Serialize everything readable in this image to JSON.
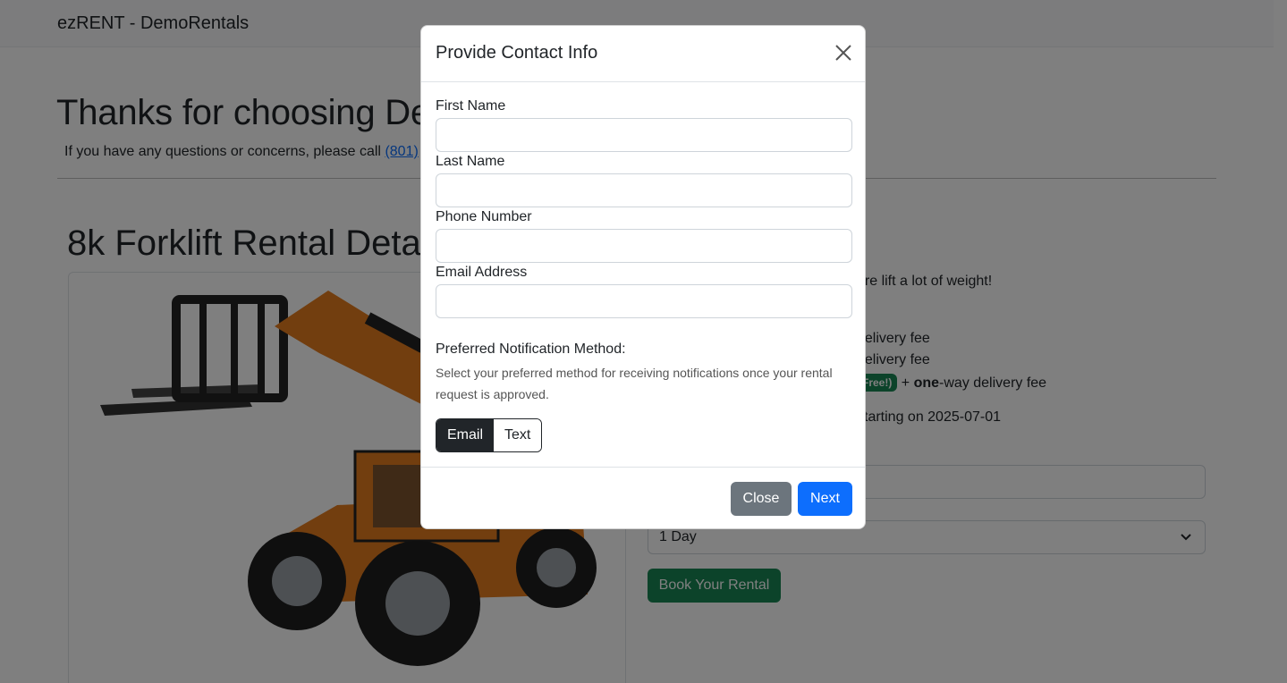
{
  "navbar": {
    "brand": "ezRENT - DemoRentals"
  },
  "hero": {
    "title": "Thanks for choosing De",
    "subtitle_prefix": "If you have any questions or concerns, please call ",
    "phone_link": "(801)"
  },
  "detail": {
    "title": "8k Forklift Rental Detai",
    "line1": "ure lift a lot of weight!",
    "line2": "delivery fee",
    "line3": "delivery fee",
    "badge": "Free!)",
    "line4_plus": " + ",
    "line4_bold": "one",
    "line4_rest": "-way delivery fee",
    "line5": "starting on 2025-07-01",
    "duration_select": "1 Day",
    "book_button": "Book Your Rental"
  },
  "modal": {
    "title": "Provide Contact Info",
    "fields": [
      {
        "label": "First Name",
        "value": "",
        "placeholder": ""
      },
      {
        "label": "Last Name",
        "value": "",
        "placeholder": ""
      },
      {
        "label": "Phone Number",
        "value": "",
        "placeholder": ""
      },
      {
        "label": "Email Address",
        "value": "",
        "placeholder": ""
      }
    ],
    "pref_label": "Preferred Notification Method:",
    "pref_help": "Select your preferred method for receiving notifications once your rental request is approved.",
    "toggle": {
      "options": [
        "Email",
        "Text"
      ],
      "selected": "Email"
    },
    "close_button": "Close",
    "next_button": "Next"
  },
  "colors": {
    "primary": "#0d6efd",
    "secondary": "#6c757d",
    "success": "#198754",
    "dark": "#212529"
  },
  "icons": {
    "close": "close-icon",
    "select_chevron": "chevron-down-icon"
  }
}
